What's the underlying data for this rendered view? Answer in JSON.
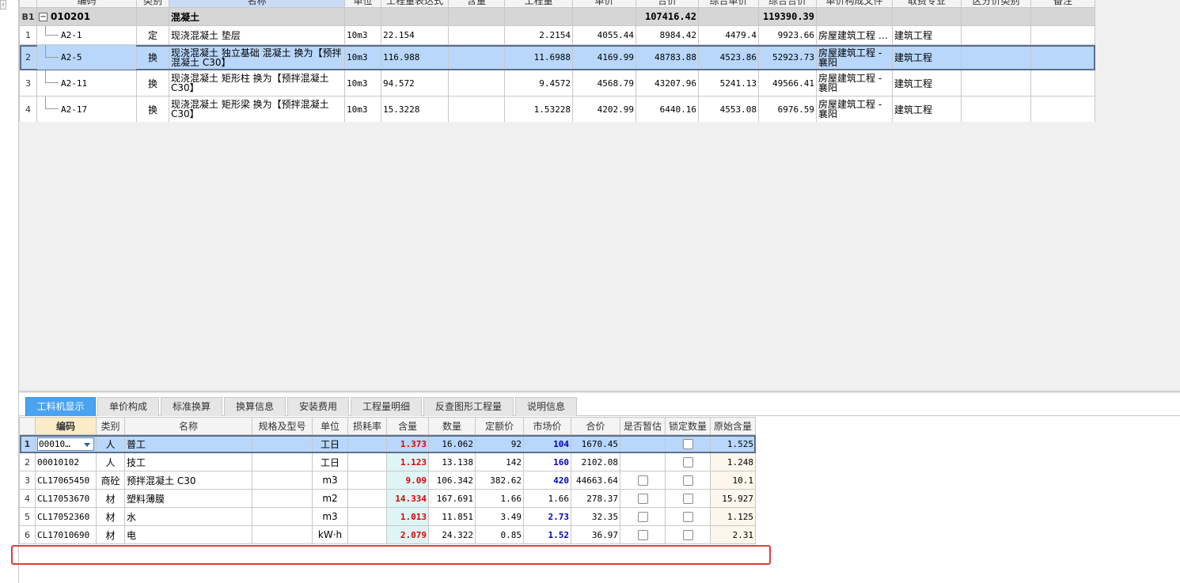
{
  "top_grid": {
    "headers": [
      "编码",
      "类别",
      "名称",
      "单位",
      "工程量表达式",
      "含量",
      "工程量",
      "单价",
      "合价",
      "综合单价",
      "综合合价",
      "单价构成文件",
      "取费专业",
      "区分价类别",
      "备注"
    ],
    "group": {
      "rownum": "B1",
      "code": "010201",
      "name": "混凝土",
      "total": "107416.42",
      "comp_total": "119390.39"
    },
    "rows": [
      {
        "rownum": "1",
        "code": "A2-1",
        "type": "定",
        "name": "现浇混凝土 垫层",
        "unit": "10m3",
        "expr": "22.154",
        "content": "",
        "qty": "2.2154",
        "price": "4055.44",
        "total": "8984.42",
        "comp_price": "4479.4",
        "comp_total": "9923.66",
        "file": "房屋建筑工程 …",
        "spec": "建筑工程"
      },
      {
        "rownum": "2",
        "code": "A2-5",
        "type": "换",
        "name": "现浇混凝土 独立基础 混凝土  换为【预拌混凝土 C30】",
        "unit": "10m3",
        "expr": "116.988",
        "content": "",
        "qty": "11.6988",
        "price": "4169.99",
        "total": "48783.88",
        "comp_price": "4523.86",
        "comp_total": "52923.73",
        "file": "房屋建筑工程 - 襄阳",
        "spec": "建筑工程"
      },
      {
        "rownum": "3",
        "code": "A2-11",
        "type": "换",
        "name": "现浇混凝土 矩形柱  换为【预拌混凝土 C30】",
        "unit": "10m3",
        "expr": "94.572",
        "content": "",
        "qty": "9.4572",
        "price": "4568.79",
        "total": "43207.96",
        "comp_price": "5241.13",
        "comp_total": "49566.41",
        "file": "房屋建筑工程 - 襄阳",
        "spec": "建筑工程"
      },
      {
        "rownum": "4",
        "code": "A2-17",
        "type": "换",
        "name": "现浇混凝土 矩形梁  换为【预拌混凝土 C30】",
        "unit": "10m3",
        "expr": "15.3228",
        "content": "",
        "qty": "1.53228",
        "price": "4202.99",
        "total": "6440.16",
        "comp_price": "4553.08",
        "comp_total": "6976.59",
        "file": "房屋建筑工程 - 襄阳",
        "spec": "建筑工程"
      }
    ]
  },
  "tabs": [
    "工料机显示",
    "单价构成",
    "标准换算",
    "换算信息",
    "安装费用",
    "工程量明细",
    "反查图形工程量",
    "说明信息"
  ],
  "bottom_grid": {
    "headers": [
      "编码",
      "类别",
      "名称",
      "规格及型号",
      "单位",
      "损耗率",
      "含量",
      "数量",
      "定额价",
      "市场价",
      "合价",
      "是否暂估",
      "锁定数量",
      "原始含量"
    ],
    "rows": [
      {
        "rownum": "1",
        "code": "00010…",
        "type": "人",
        "name": "普工",
        "spec": "",
        "unit": "工日",
        "loss": "",
        "content": "1.373",
        "qty": "16.062",
        "quota": "92",
        "market": "104",
        "total": "1670.45",
        "est": false,
        "lock": false,
        "orig": "1.525"
      },
      {
        "rownum": "2",
        "code": "00010102",
        "type": "人",
        "name": "技工",
        "spec": "",
        "unit": "工日",
        "loss": "",
        "content": "1.123",
        "qty": "13.138",
        "quota": "142",
        "market": "160",
        "total": "2102.08",
        "est": false,
        "lock": false,
        "orig": "1.248"
      },
      {
        "rownum": "3",
        "code": "CL17065450",
        "type": "商砼",
        "name": "预拌混凝土 C30",
        "spec": "",
        "unit": "m3",
        "loss": "",
        "content": "9.09",
        "qty": "106.342",
        "quota": "382.62",
        "market": "420",
        "total": "44663.64",
        "est": true,
        "lock": false,
        "orig": "10.1"
      },
      {
        "rownum": "4",
        "code": "CL17053670",
        "type": "材",
        "name": "塑料薄膜",
        "spec": "",
        "unit": "m2",
        "loss": "",
        "content": "14.334",
        "qty": "167.691",
        "quota": "1.66",
        "market": "1.66",
        "total": "278.37",
        "est": true,
        "lock": false,
        "orig": "15.927"
      },
      {
        "rownum": "5",
        "code": "CL17052360",
        "type": "材",
        "name": "水",
        "spec": "",
        "unit": "m3",
        "loss": "",
        "content": "1.013",
        "qty": "11.851",
        "quota": "3.49",
        "market": "2.73",
        "total": "32.35",
        "est": true,
        "lock": false,
        "orig": "1.125"
      },
      {
        "rownum": "6",
        "code": "CL17010690",
        "type": "材",
        "name": "电",
        "spec": "",
        "unit": "kW·h",
        "loss": "",
        "content": "2.079",
        "qty": "24.322",
        "quota": "0.85",
        "market": "1.52",
        "total": "36.97",
        "est": true,
        "lock": false,
        "orig": "2.31"
      }
    ]
  },
  "colors": {
    "active_tab": "#4aa3f0",
    "selection": "#b8d7fb",
    "content_red": "#e00000",
    "market_blue": "#0000c0",
    "highlight_box": "#e53b3b"
  }
}
